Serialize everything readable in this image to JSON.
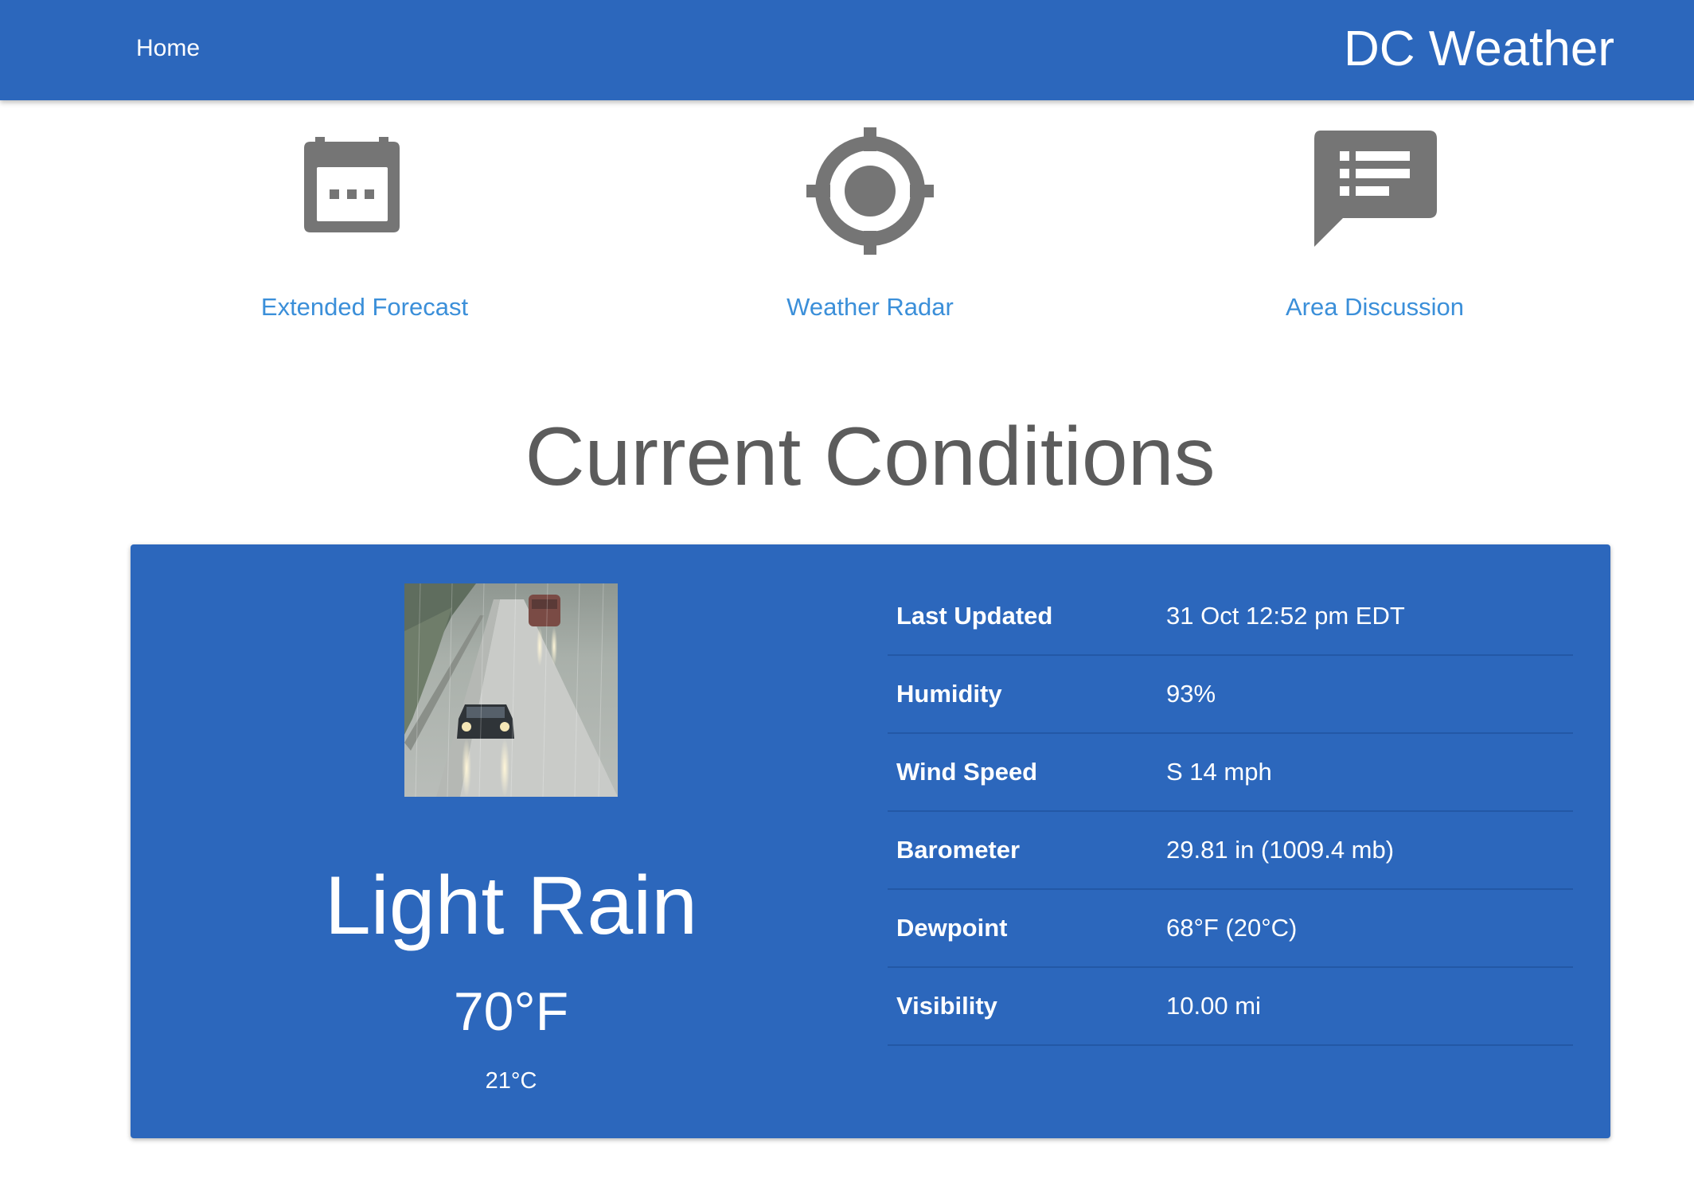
{
  "nav": {
    "home_label": "Home",
    "brand": "DC Weather",
    "bg_color": "#2c67bc"
  },
  "features": [
    {
      "label": "Extended Forecast",
      "icon": "calendar-icon"
    },
    {
      "label": "Weather Radar",
      "icon": "crosshair-icon"
    },
    {
      "label": "Area Discussion",
      "icon": "speech-bubble-list-icon"
    }
  ],
  "main": {
    "title": "Current Conditions"
  },
  "current": {
    "image": "light-rain-road-photo",
    "condition": "Light Rain",
    "temp_f": "70°F",
    "temp_c": "21°C",
    "details": [
      {
        "label": "Last Updated",
        "value": "31 Oct 12:52 pm EDT"
      },
      {
        "label": "Humidity",
        "value": "93%"
      },
      {
        "label": "Wind Speed",
        "value": "S 14 mph"
      },
      {
        "label": "Barometer",
        "value": "29.81 in (1009.4 mb)"
      },
      {
        "label": "Dewpoint",
        "value": "68°F (20°C)"
      },
      {
        "label": "Visibility",
        "value": "10.00 mi"
      }
    ]
  },
  "colors": {
    "accent": "#2c67bc",
    "link": "#3b8fd9",
    "icon": "#757575",
    "title": "#5c5c5c"
  }
}
